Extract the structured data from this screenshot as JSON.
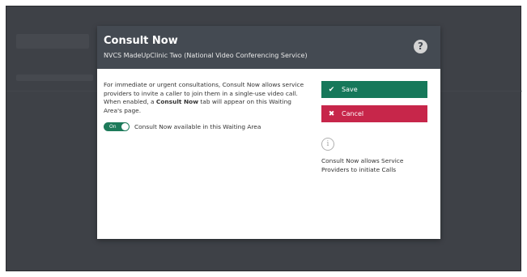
{
  "modal": {
    "title": "Consult Now",
    "subtitle": "NVCS MadeUpClinic Two (National Video Conferencing Service)",
    "help_icon": "question-circle-icon",
    "description_part1": "For immediate or urgent consultations, Consult Now allows service providers to invite a caller to join them in a single-use video call. When enabled, a ",
    "description_bold": "Consult Now",
    "description_part2": " tab will appear on this Waiting Area's page.",
    "toggle": {
      "state_label": "On",
      "checked": true,
      "label": "Consult Now available in this Waiting Area"
    },
    "save_label": "Save",
    "save_icon": "check-icon",
    "cancel_label": "Cancel",
    "cancel_icon": "x-icon",
    "info_icon": "info-circle-icon",
    "info_text": "Consult Now allows Service Providers to initiate Calls"
  },
  "colors": {
    "header_bg": "#444a52",
    "save": "#16785a",
    "cancel": "#c7264a",
    "toggle": "#1d7a5a",
    "overlay": "#3e4147"
  }
}
